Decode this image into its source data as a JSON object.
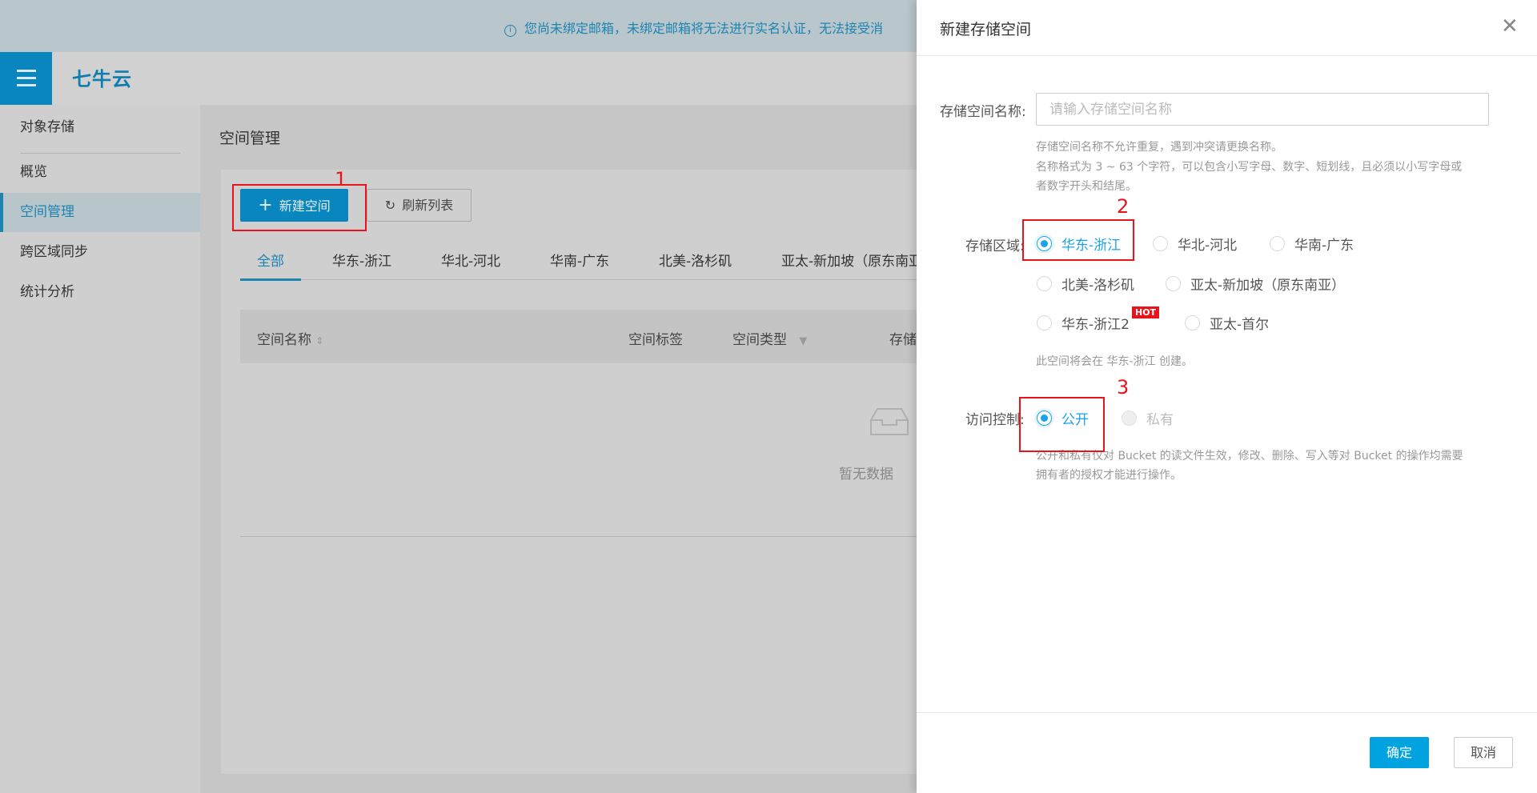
{
  "banner": {
    "text": "您尚未绑定邮箱，未绑定邮箱将无法进行实名认证，无法接受消"
  },
  "header": {
    "logo": "七牛云"
  },
  "sidebar": {
    "section": "对象存储",
    "items": [
      {
        "label": "概览"
      },
      {
        "label": "空间管理"
      },
      {
        "label": "跨区域同步"
      },
      {
        "label": "统计分析"
      }
    ]
  },
  "main": {
    "title": "空间管理",
    "new_button": "新建空间",
    "refresh_button": "刷新列表",
    "tabs": [
      {
        "label": "全部"
      },
      {
        "label": "华东-浙江"
      },
      {
        "label": "华北-河北"
      },
      {
        "label": "华南-广东"
      },
      {
        "label": "北美-洛杉矶"
      },
      {
        "label": "亚太-新加坡（原东南亚"
      }
    ],
    "columns": [
      "空间名称",
      "空间标签",
      "空间类型",
      "存储"
    ],
    "empty_text": "暂无数据"
  },
  "annotations": [
    "1",
    "2",
    "3"
  ],
  "drawer": {
    "title": "新建存储空间",
    "name_label": "存储空间名称:",
    "name_placeholder": "请输入存储空间名称",
    "name_value": "",
    "name_help": [
      "存储空间名称不允许重复，遇到冲突请更换名称。",
      "名称格式为 3 ~ 63 个字符，可以包含小写字母、数字、短划线，且必须以小写字母或",
      "者数字开头和结尾。"
    ],
    "region_label": "存储区域:",
    "regions": [
      {
        "label": "华东-浙江",
        "checked": true
      },
      {
        "label": "华北-河北"
      },
      {
        "label": "华南-广东"
      },
      {
        "label": "北美-洛杉矶"
      },
      {
        "label": "亚太-新加坡（原东南亚）"
      },
      {
        "label": "华东-浙江2",
        "badge": "HOT"
      },
      {
        "label": "亚太-首尔"
      }
    ],
    "region_note": "此空间将会在 华东-浙江 创建。",
    "access_label": "访问控制:",
    "access": [
      {
        "label": "公开",
        "checked": true
      },
      {
        "label": "私有",
        "disabled": true
      }
    ],
    "access_help": [
      "公开和私有仅对 Bucket 的读文件生效，修改、删除、写入等对 Bucket 的操作均需要",
      "拥有者的授权才能进行操作。"
    ],
    "ok": "确定",
    "cancel": "取消"
  },
  "colors": {
    "accent": "#1aa3e8",
    "primary_button": "#00a3e0",
    "annotation": "#e8141c"
  }
}
